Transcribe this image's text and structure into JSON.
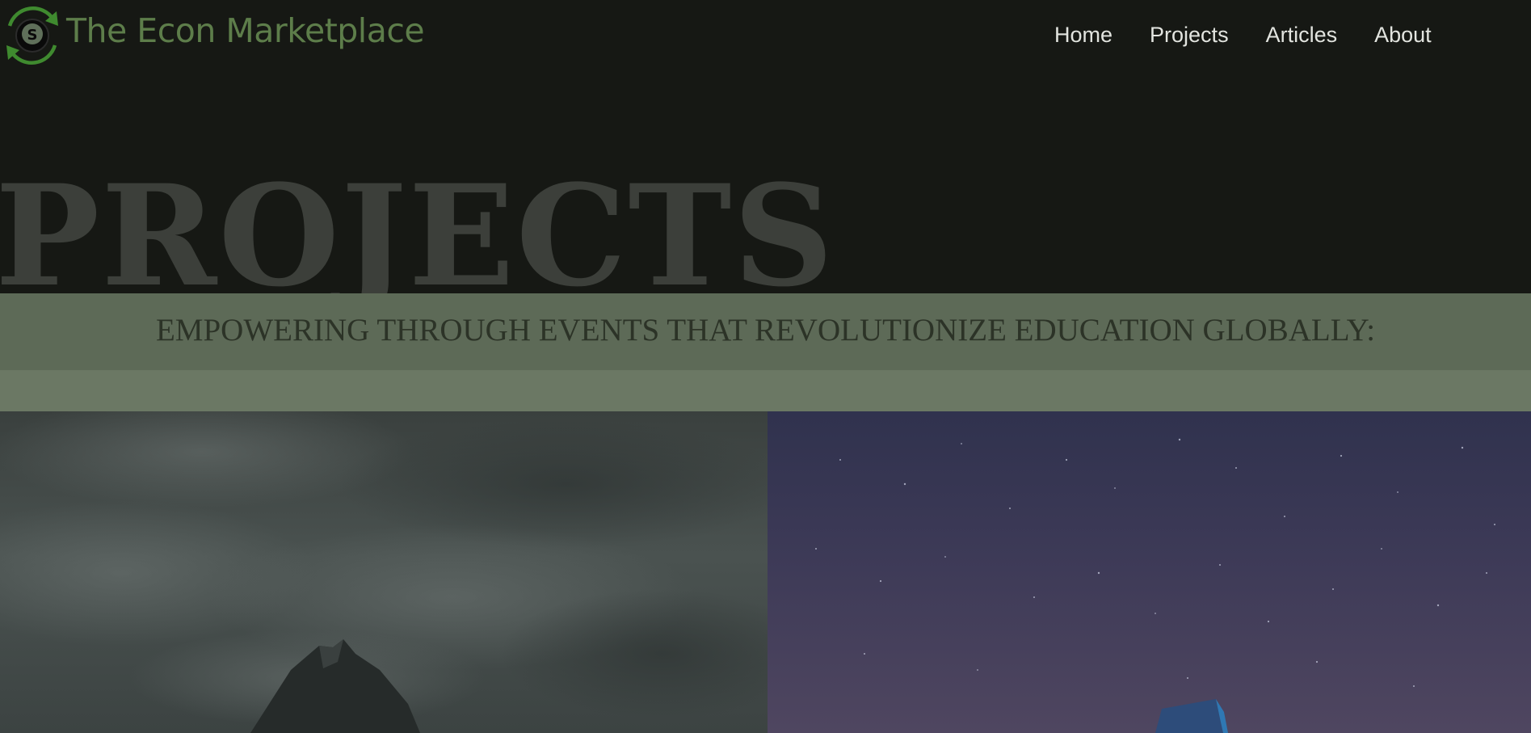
{
  "site": {
    "brand": "The Econ Marketplace",
    "logo_letter": "S",
    "brand_color": "#5d7d4a"
  },
  "nav": {
    "items": [
      {
        "label": "Home"
      },
      {
        "label": "Projects"
      },
      {
        "label": "Articles"
      },
      {
        "label": "About"
      }
    ]
  },
  "hero": {
    "title": "PROJECTS",
    "tagline": "EMPOWERING THROUGH EVENTS THAT REVOLUTIONIZE EDUCATION GLOBALLY:"
  },
  "cards": [
    {
      "image": "mountain-peak-under-cloudy-sky"
    },
    {
      "image": "night-sky-with-stars-and-tent"
    }
  ]
}
